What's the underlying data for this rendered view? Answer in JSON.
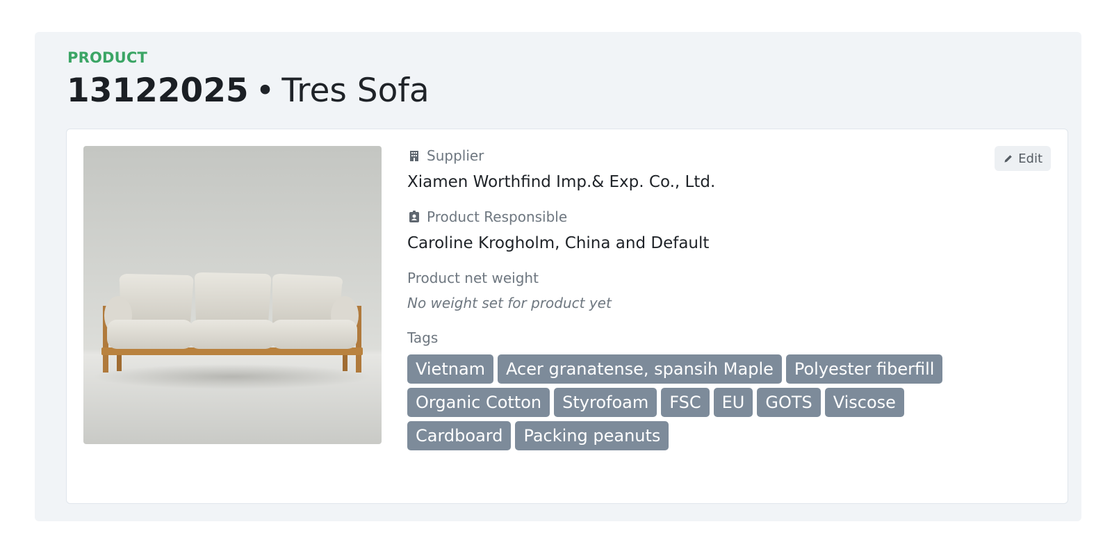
{
  "header": {
    "eyebrow": "PRODUCT",
    "product_number": "13122025",
    "separator": "•",
    "product_name": "Tres Sofa"
  },
  "card": {
    "edit_label": "Edit",
    "image_alt": "sofa-photo",
    "supplier": {
      "label": "Supplier",
      "icon": "building-icon",
      "value": "Xiamen Worthfind Imp.& Exp. Co., Ltd."
    },
    "responsible": {
      "label": "Product Responsible",
      "icon": "id-badge-icon",
      "value": "Caroline Krogholm, China and Default"
    },
    "weight": {
      "label": "Product net weight",
      "value": "No weight set for product yet"
    },
    "tags": {
      "label": "Tags",
      "items": [
        "Vietnam",
        "Acer granatense, spansih Maple",
        "Polyester fiberfill",
        "Organic Cotton",
        "Styrofoam",
        "FSC",
        "EU",
        "GOTS",
        "Viscose",
        "Cardboard",
        "Packing peanuts"
      ]
    }
  },
  "colors": {
    "accent": "#3ba565",
    "tag_bg": "#7d8b9a",
    "panel_bg": "#f1f4f7"
  }
}
